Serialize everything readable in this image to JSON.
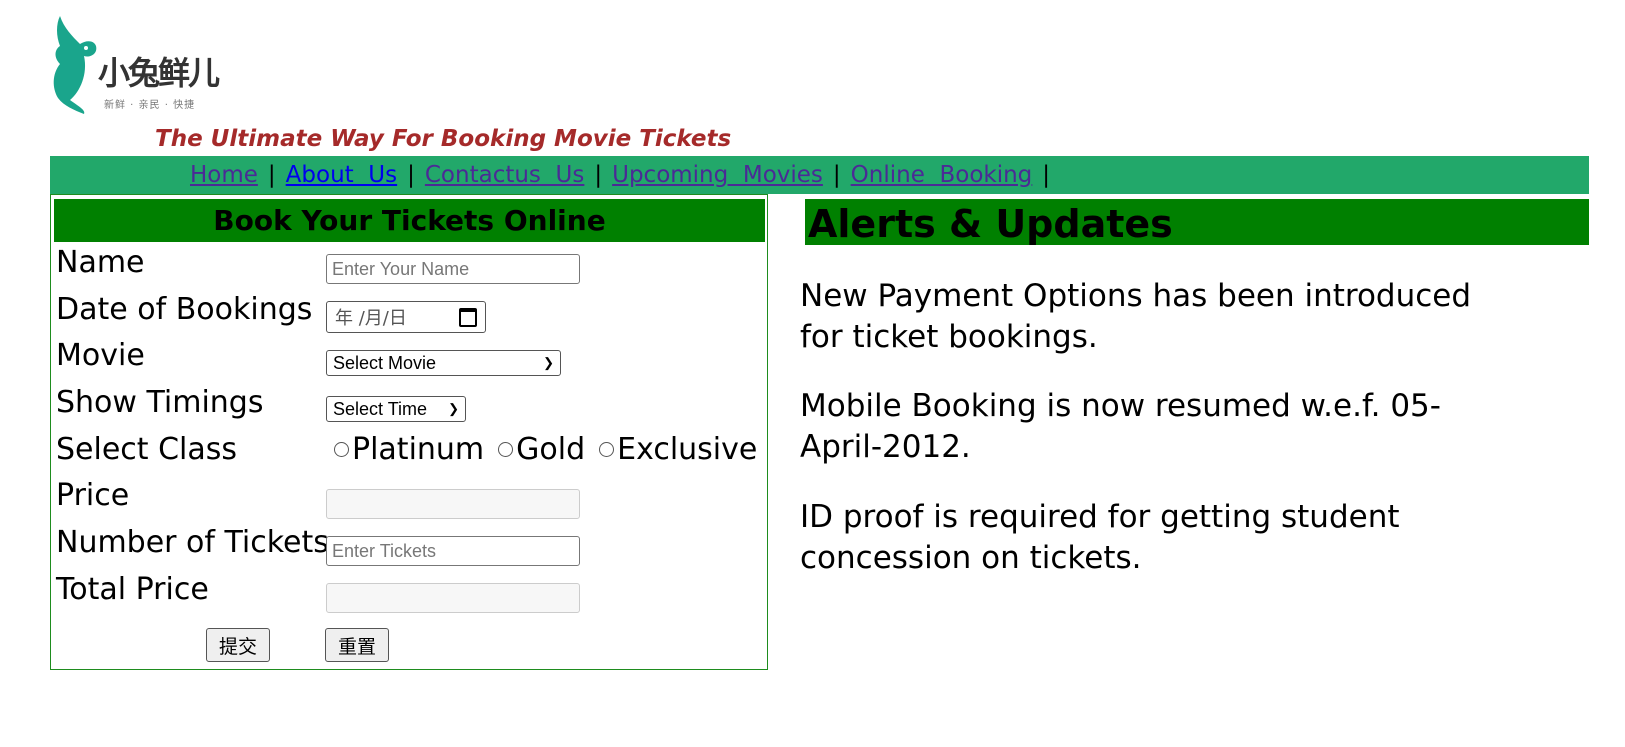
{
  "brand": {
    "logo_text": "小兔鲜儿",
    "logo_subtext": "新鲜 · 亲民 · 快捷",
    "tagline": "The Ultimate Way For Booking Movie Tickets"
  },
  "nav": {
    "items": [
      {
        "label": "Home"
      },
      {
        "label": "About  Us"
      },
      {
        "label": "Contactus  Us"
      },
      {
        "label": "Upcoming  Movies"
      },
      {
        "label": "Online  Booking"
      }
    ],
    "separator": "|"
  },
  "form": {
    "heading": "Book Your Tickets Online",
    "name_label": "Name",
    "name_placeholder": "Enter Your Name",
    "date_label": "Date of Bookings",
    "date_placeholder": "年 /月/日",
    "movie_label": "Movie",
    "movie_selected": "Select Movie",
    "timing_label": "Show Timings",
    "timing_selected": "Select Time",
    "class_label": "Select Class",
    "class_options": [
      "Platinum",
      "Gold",
      "Exclusive"
    ],
    "price_label": "Price",
    "tickets_label": "Number of Tickets",
    "tickets_placeholder": "Enter Tickets",
    "total_label": "Total Price",
    "submit_label": "提交",
    "reset_label": "重置"
  },
  "alerts": {
    "heading": "Alerts & Updates",
    "items": [
      "New Payment Options has been introduced for ticket bookings.",
      "Mobile Booking is now resumed w.e.f. 05-April-2012.",
      "ID proof is required for getting student concession on tickets."
    ]
  },
  "colors": {
    "nav_bg": "#22a86a",
    "heading_bg": "#008000",
    "tagline": "#a52a2a"
  }
}
